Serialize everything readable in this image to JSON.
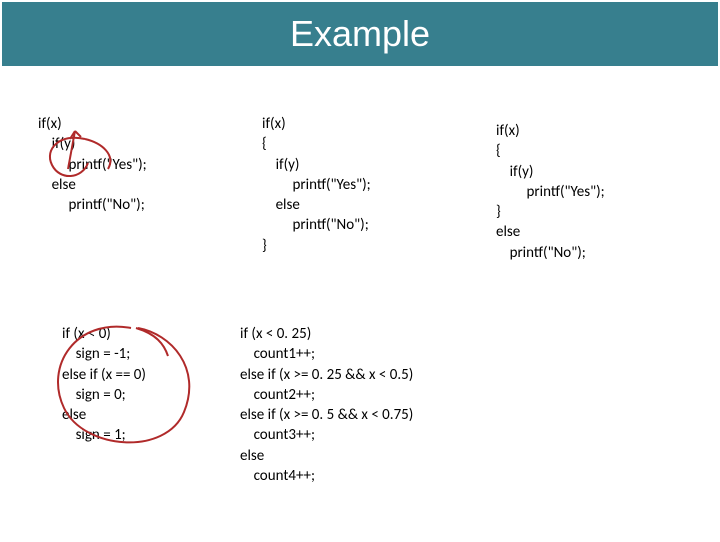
{
  "header": {
    "title": "Example"
  },
  "code": {
    "block1": "if(x)\n    if(y)\n         printf(\"Yes\");\n    else\n         printf(\"No\");",
    "block2": "if(x)\n{\n    if(y)\n         printf(\"Yes\");\n    else\n         printf(\"No\");\n}",
    "block3": "if(x)\n{\n    if(y)\n         printf(\"Yes\");\n}\nelse\n    printf(\"No\");",
    "block4": "if (x < 0)\n    sign = -1;\nelse if (x == 0)\n    sign = 0;\nelse\n    sign = 1;",
    "block5": "if (x < 0. 25)\n    count1++;\nelse if (x >= 0. 25 && x < 0.5)\n    count2++;\nelse if (x >= 0. 5 && x < 0.75)\n    count3++;\nelse\n    count4++;"
  }
}
